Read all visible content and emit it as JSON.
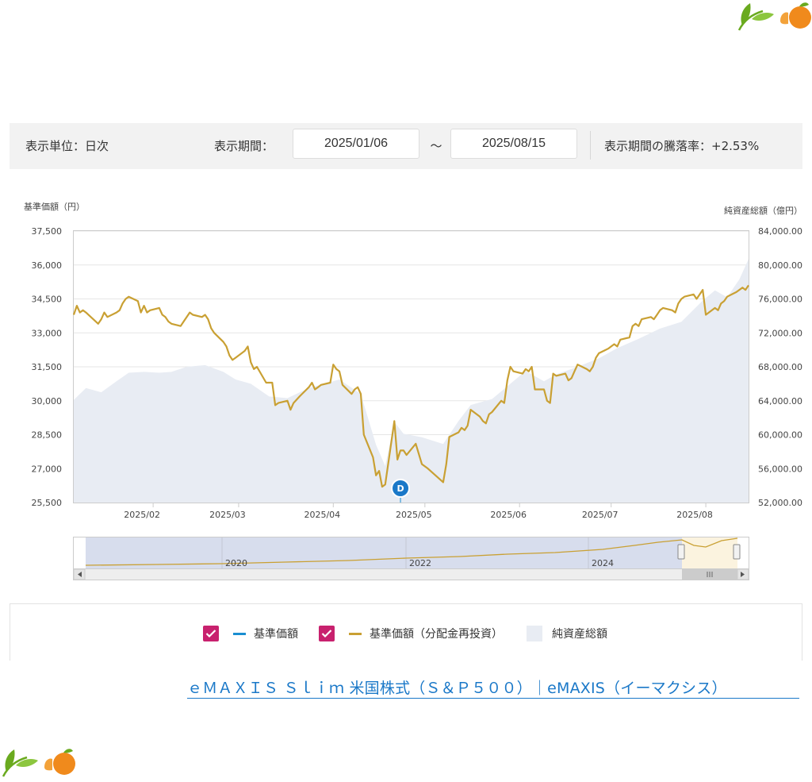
{
  "controls": {
    "unit_label": "表示単位：日次",
    "period_label": "表示期間：",
    "start_date": "2025/01/06",
    "tilde": "～",
    "end_date": "2025/08/15",
    "change_label": "表示期間の騰落率：+2.53%"
  },
  "chart_data": {
    "type": "line",
    "left_axis_title": "基準価額（円）",
    "right_axis_title": "純資産総額（億円）",
    "y_left": {
      "min": 25500,
      "max": 37500,
      "ticks": [
        "37,500",
        "36,000",
        "34,500",
        "33,000",
        "31,500",
        "30,000",
        "28,500",
        "27,000",
        "25,500"
      ]
    },
    "y_right": {
      "min": 52000,
      "max": 84000,
      "ticks": [
        "84,000.00",
        "80,000.00",
        "76,000.00",
        "72,000.00",
        "68,000.00",
        "64,000.00",
        "60,000.00",
        "56,000.00",
        "52,000.00"
      ]
    },
    "x_ticks": [
      "2025/02",
      "2025/03",
      "2025/04",
      "2025/05",
      "2025/06",
      "2025/07",
      "2025/08"
    ],
    "x_tick_dates": [
      "2025-02-01",
      "2025-03-01",
      "2025-04-01",
      "2025-05-01",
      "2025-06-01",
      "2025-07-01",
      "2025-08-01"
    ],
    "x_range": [
      "2025-01-06",
      "2025-08-15"
    ],
    "marker": {
      "date": "2025-04-23",
      "value": 25500,
      "label": "D"
    },
    "series": [
      {
        "name": "基準価額（分配金再投資）",
        "color": "#c9a033",
        "axis": "left",
        "points": [
          [
            "2025-01-06",
            33800
          ],
          [
            "2025-01-07",
            34200
          ],
          [
            "2025-01-08",
            33900
          ],
          [
            "2025-01-09",
            34000
          ],
          [
            "2025-01-10",
            33900
          ],
          [
            "2025-01-14",
            33400
          ],
          [
            "2025-01-15",
            33600
          ],
          [
            "2025-01-16",
            33900
          ],
          [
            "2025-01-17",
            33700
          ],
          [
            "2025-01-20",
            33900
          ],
          [
            "2025-01-21",
            34000
          ],
          [
            "2025-01-22",
            34300
          ],
          [
            "2025-01-23",
            34500
          ],
          [
            "2025-01-24",
            34600
          ],
          [
            "2025-01-27",
            34400
          ],
          [
            "2025-01-28",
            33900
          ],
          [
            "2025-01-29",
            34200
          ],
          [
            "2025-01-30",
            33900
          ],
          [
            "2025-01-31",
            34000
          ],
          [
            "2025-02-03",
            34100
          ],
          [
            "2025-02-04",
            33800
          ],
          [
            "2025-02-05",
            33700
          ],
          [
            "2025-02-06",
            33500
          ],
          [
            "2025-02-07",
            33400
          ],
          [
            "2025-02-10",
            33300
          ],
          [
            "2025-02-11",
            33500
          ],
          [
            "2025-02-12",
            33700
          ],
          [
            "2025-02-13",
            33900
          ],
          [
            "2025-02-14",
            33800
          ],
          [
            "2025-02-17",
            33700
          ],
          [
            "2025-02-18",
            33800
          ],
          [
            "2025-02-19",
            33600
          ],
          [
            "2025-02-20",
            33200
          ],
          [
            "2025-02-21",
            33000
          ],
          [
            "2025-02-24",
            32600
          ],
          [
            "2025-02-25",
            32400
          ],
          [
            "2025-02-26",
            32000
          ],
          [
            "2025-02-27",
            31800
          ],
          [
            "2025-02-28",
            31900
          ],
          [
            "2025-03-03",
            32200
          ],
          [
            "2025-03-04",
            32400
          ],
          [
            "2025-03-05",
            31700
          ],
          [
            "2025-03-06",
            31400
          ],
          [
            "2025-03-07",
            31500
          ],
          [
            "2025-03-10",
            30800
          ],
          [
            "2025-03-11",
            30800
          ],
          [
            "2025-03-12",
            30800
          ],
          [
            "2025-03-13",
            29800
          ],
          [
            "2025-03-14",
            29900
          ],
          [
            "2025-03-17",
            30000
          ],
          [
            "2025-03-18",
            29600
          ],
          [
            "2025-03-19",
            29900
          ],
          [
            "2025-03-21",
            30200
          ],
          [
            "2025-03-24",
            30600
          ],
          [
            "2025-03-25",
            30800
          ],
          [
            "2025-03-26",
            30500
          ],
          [
            "2025-03-27",
            30600
          ],
          [
            "2025-03-28",
            30700
          ],
          [
            "2025-03-31",
            30800
          ],
          [
            "2025-04-01",
            31600
          ],
          [
            "2025-04-02",
            31400
          ],
          [
            "2025-04-03",
            31300
          ],
          [
            "2025-04-04",
            30700
          ],
          [
            "2025-04-07",
            30300
          ],
          [
            "2025-04-08",
            30500
          ],
          [
            "2025-04-09",
            30600
          ],
          [
            "2025-04-10",
            30300
          ],
          [
            "2025-04-11",
            28500
          ],
          [
            "2025-04-14",
            27500
          ],
          [
            "2025-04-15",
            26700
          ],
          [
            "2025-04-16",
            26900
          ],
          [
            "2025-04-17",
            26200
          ],
          [
            "2025-04-18",
            26300
          ],
          [
            "2025-04-21",
            29100
          ],
          [
            "2025-04-22",
            27400
          ],
          [
            "2025-04-23",
            27800
          ],
          [
            "2025-04-24",
            27800
          ],
          [
            "2025-04-25",
            27600
          ],
          [
            "2025-04-28",
            28100
          ],
          [
            "2025-04-30",
            27200
          ],
          [
            "2025-05-01",
            27100
          ],
          [
            "2025-05-02",
            27000
          ],
          [
            "2025-05-07",
            26400
          ],
          [
            "2025-05-08",
            27200
          ],
          [
            "2025-05-09",
            28400
          ],
          [
            "2025-05-12",
            28600
          ],
          [
            "2025-05-13",
            28800
          ],
          [
            "2025-05-14",
            28700
          ],
          [
            "2025-05-15",
            28900
          ],
          [
            "2025-05-16",
            29600
          ],
          [
            "2025-05-19",
            29300
          ],
          [
            "2025-05-20",
            29100
          ],
          [
            "2025-05-21",
            29000
          ],
          [
            "2025-05-22",
            29400
          ],
          [
            "2025-05-23",
            29500
          ],
          [
            "2025-05-26",
            30000
          ],
          [
            "2025-05-27",
            29900
          ],
          [
            "2025-05-28",
            30900
          ],
          [
            "2025-05-29",
            31500
          ],
          [
            "2025-05-30",
            31300
          ],
          [
            "2025-06-02",
            31200
          ],
          [
            "2025-06-03",
            31400
          ],
          [
            "2025-06-04",
            31300
          ],
          [
            "2025-06-05",
            31500
          ],
          [
            "2025-06-06",
            30500
          ],
          [
            "2025-06-09",
            30500
          ],
          [
            "2025-06-10",
            30000
          ],
          [
            "2025-06-11",
            29900
          ],
          [
            "2025-06-12",
            31200
          ],
          [
            "2025-06-13",
            31100
          ],
          [
            "2025-06-16",
            31200
          ],
          [
            "2025-06-17",
            30900
          ],
          [
            "2025-06-18",
            31000
          ],
          [
            "2025-06-19",
            31300
          ],
          [
            "2025-06-20",
            31600
          ],
          [
            "2025-06-23",
            31400
          ],
          [
            "2025-06-24",
            31300
          ],
          [
            "2025-06-25",
            31500
          ],
          [
            "2025-06-26",
            31900
          ],
          [
            "2025-06-27",
            32100
          ],
          [
            "2025-06-30",
            32300
          ],
          [
            "2025-07-01",
            32400
          ],
          [
            "2025-07-02",
            32500
          ],
          [
            "2025-07-03",
            32400
          ],
          [
            "2025-07-04",
            32700
          ],
          [
            "2025-07-07",
            32800
          ],
          [
            "2025-07-08",
            33300
          ],
          [
            "2025-07-09",
            33400
          ],
          [
            "2025-07-10",
            33300
          ],
          [
            "2025-07-11",
            33600
          ],
          [
            "2025-07-14",
            33700
          ],
          [
            "2025-07-15",
            33600
          ],
          [
            "2025-07-16",
            33800
          ],
          [
            "2025-07-17",
            34000
          ],
          [
            "2025-07-18",
            34100
          ],
          [
            "2025-07-21",
            34000
          ],
          [
            "2025-07-22",
            33900
          ],
          [
            "2025-07-23",
            34300
          ],
          [
            "2025-07-24",
            34500
          ],
          [
            "2025-07-25",
            34600
          ],
          [
            "2025-07-28",
            34700
          ],
          [
            "2025-07-29",
            34500
          ],
          [
            "2025-07-30",
            34700
          ],
          [
            "2025-07-31",
            34900
          ],
          [
            "2025-08-01",
            33800
          ],
          [
            "2025-08-04",
            34100
          ],
          [
            "2025-08-05",
            34000
          ],
          [
            "2025-08-06",
            34300
          ],
          [
            "2025-08-07",
            34400
          ],
          [
            "2025-08-08",
            34600
          ],
          [
            "2025-08-11",
            34800
          ],
          [
            "2025-08-12",
            34900
          ],
          [
            "2025-08-13",
            35000
          ],
          [
            "2025-08-14",
            34900
          ],
          [
            "2025-08-15",
            35100
          ]
        ]
      },
      {
        "name": "純資産総額",
        "color": "#e8ecf3",
        "axis": "right",
        "points": [
          [
            "2025-01-06",
            64100
          ],
          [
            "2025-01-10",
            65500
          ],
          [
            "2025-01-15",
            65000
          ],
          [
            "2025-01-20",
            66300
          ],
          [
            "2025-01-24",
            67300
          ],
          [
            "2025-01-29",
            67400
          ],
          [
            "2025-02-03",
            67300
          ],
          [
            "2025-02-07",
            67400
          ],
          [
            "2025-02-12",
            68000
          ],
          [
            "2025-02-18",
            68200
          ],
          [
            "2025-02-24",
            67400
          ],
          [
            "2025-02-28",
            66500
          ],
          [
            "2025-03-05",
            66000
          ],
          [
            "2025-03-11",
            64500
          ],
          [
            "2025-03-17",
            64300
          ],
          [
            "2025-03-24",
            65500
          ],
          [
            "2025-03-31",
            66200
          ],
          [
            "2025-04-03",
            66500
          ],
          [
            "2025-04-10",
            64800
          ],
          [
            "2025-04-15",
            58800
          ],
          [
            "2025-04-18",
            56300
          ],
          [
            "2025-04-21",
            61500
          ],
          [
            "2025-04-24",
            60100
          ],
          [
            "2025-04-30",
            59700
          ],
          [
            "2025-05-07",
            58900
          ],
          [
            "2025-05-12",
            61600
          ],
          [
            "2025-05-16",
            63500
          ],
          [
            "2025-05-23",
            64200
          ],
          [
            "2025-05-29",
            66000
          ],
          [
            "2025-06-03",
            67500
          ],
          [
            "2025-06-09",
            66300
          ],
          [
            "2025-06-13",
            67100
          ],
          [
            "2025-06-20",
            68000
          ],
          [
            "2025-06-27",
            69000
          ],
          [
            "2025-07-03",
            70200
          ],
          [
            "2025-07-10",
            71300
          ],
          [
            "2025-07-17",
            72500
          ],
          [
            "2025-07-24",
            73300
          ],
          [
            "2025-07-31",
            75800
          ],
          [
            "2025-08-04",
            77000
          ],
          [
            "2025-08-08",
            76200
          ],
          [
            "2025-08-12",
            78300
          ],
          [
            "2025-08-15",
            80700
          ]
        ]
      }
    ]
  },
  "navigator": {
    "year_labels": [
      "2020",
      "2022",
      "2024"
    ]
  },
  "legend": {
    "items": [
      {
        "label": "基準価額",
        "color": "#1a8ed1"
      },
      {
        "label": "基準価額（分配金再投資）",
        "color": "#c9a033"
      },
      {
        "label": "純資産総額",
        "color": "#e8ecf3"
      }
    ]
  },
  "link": {
    "text": "ｅＭＡＸＩＳ Ｓｌｉｍ 米国株式（Ｓ＆Ｐ５００）｜eMAXIS（イーマクシス）"
  },
  "decoration": {
    "leaf_color": "#6aaa1f",
    "orange_color": "#f08a1c"
  }
}
